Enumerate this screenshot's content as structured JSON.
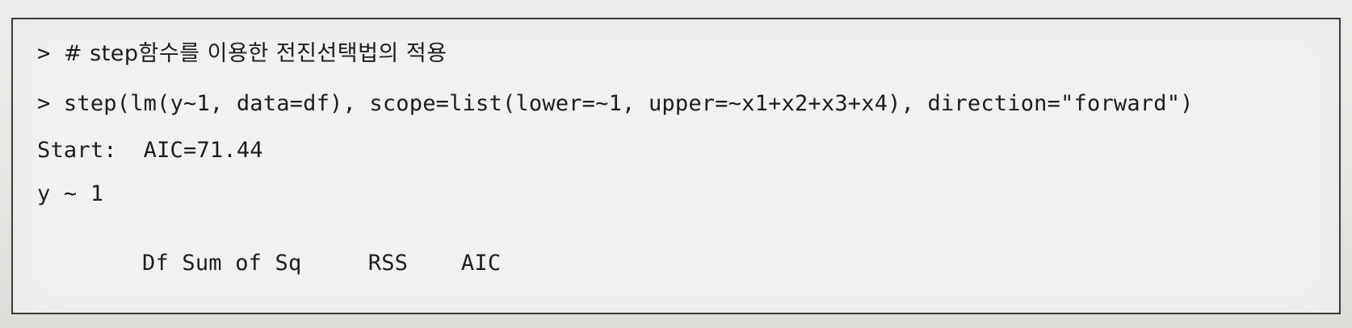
{
  "console": {
    "line1": {
      "prompt": "> ",
      "comment": "# step함수를 이용한 전진선택법의 적용"
    },
    "line2": {
      "prompt": "> ",
      "code": "step(lm(y~1, data=df), scope=list(lower=~1, upper=~x1+x2+x3+x4), direction=\"forward\")"
    },
    "line3": "Start:  AIC=71.44",
    "line4": "y ~ 1",
    "line5": "Df Sum of Sq     RSS    AIC"
  }
}
